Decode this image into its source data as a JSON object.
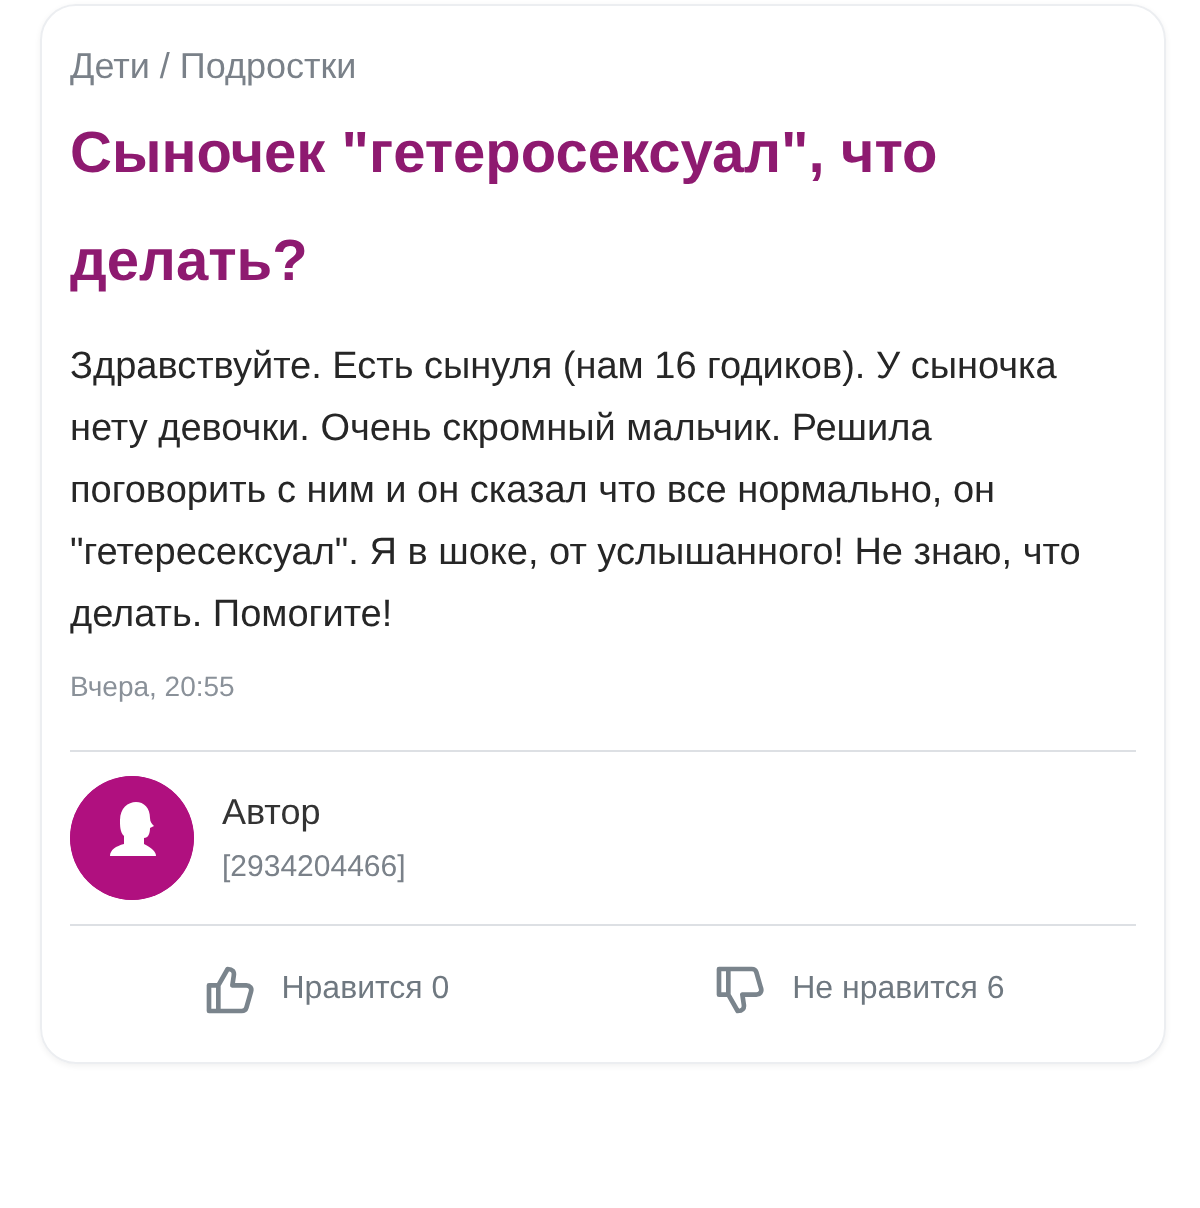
{
  "breadcrumb": "Дети / Подростки",
  "title": "Сыночек \"гетеросексуал\", что делать?",
  "body": "Здравствуйте. Есть сынуля (нам 16 годиков). У сыночка нету девочки. Очень скромный мальчик. Решила поговорить с ним и он сказал что все нормально, он \"гетересексуал\". Я в шоке, от услышанного! Не знаю, что делать. Помогите!",
  "time": "Вчера, 20:55",
  "author": {
    "name": "Автор",
    "id": "[2934204466]"
  },
  "reactions": [
    {
      "kind": "like",
      "label": "Нравится 0"
    },
    {
      "kind": "dislike",
      "label": "Не нравится 6"
    }
  ]
}
